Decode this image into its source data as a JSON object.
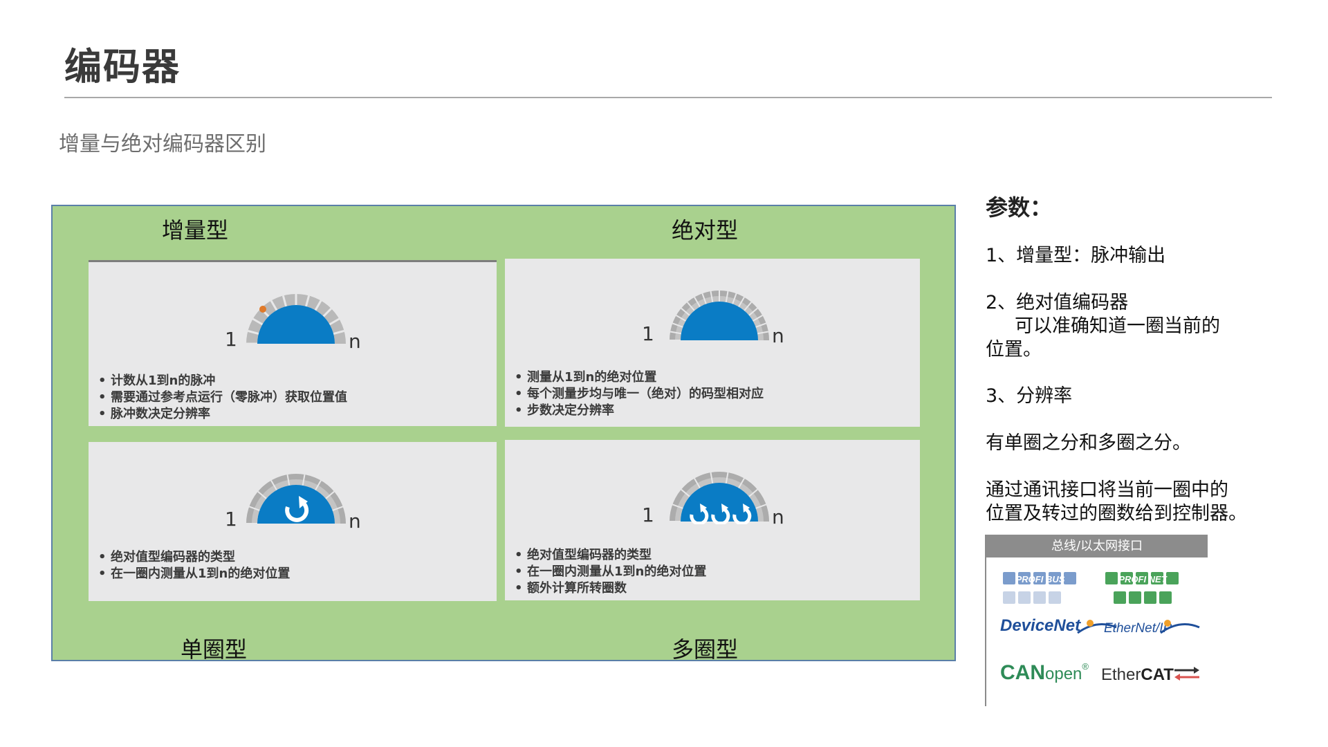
{
  "page": {
    "title": "编码器",
    "subtitle": "增量与绝对编码器区别"
  },
  "diagram": {
    "labels": {
      "incremental": "增量型",
      "absolute": "绝对型",
      "single_turn": "单圈型",
      "multi_turn": "多圈型"
    },
    "dial_start": "1",
    "dial_end": "n",
    "cards": [
      {
        "bullets": [
          "计数从1到n的脉冲",
          "需要通过参考点运行（零脉冲）获取位置值",
          "脉冲数决定分辨率"
        ]
      },
      {
        "bullets": [
          "测量从1到n的绝对位置",
          "每个测量步均与唯一（绝对）的码型相对应",
          "步数决定分辨率"
        ]
      },
      {
        "bullets": [
          "绝对值型编码器的类型",
          "在一圈内测量从1到n的绝对位置"
        ]
      },
      {
        "bullets": [
          "绝对值型编码器的类型",
          "在一圈内测量从1到n的绝对位置",
          "额外计算所转圈数"
        ]
      }
    ],
    "colors": {
      "panel": "#a9d18e",
      "dial_blue": "#0a7cc5",
      "marker": "#e07a2a"
    }
  },
  "params": {
    "title": "参数：",
    "item1": "1、增量型：脉冲输出",
    "item2_line1": "2、绝对值编码器",
    "item2_line2": "可以准确知道一圈当前的",
    "item2_line3": "位置。",
    "item3": "3、分辨率",
    "note1": "有单圈之分和多圈之分。",
    "note2_line1": "通过通讯接口将当前一圈中的",
    "note2_line2": "位置及转过的圈数给到控制器。"
  },
  "bus": {
    "header": "总线/以太网接口",
    "logos": {
      "profibus": "PROFI BUS",
      "profinet": "PROFI NET",
      "devicenet": "DeviceNet",
      "ethernetip": "EtherNet/IP",
      "canopen_can": "CAN",
      "canopen_open": "open",
      "canopen_reg": "®",
      "ethercat_ether": "Ether",
      "ethercat_cat": "CAT"
    }
  }
}
